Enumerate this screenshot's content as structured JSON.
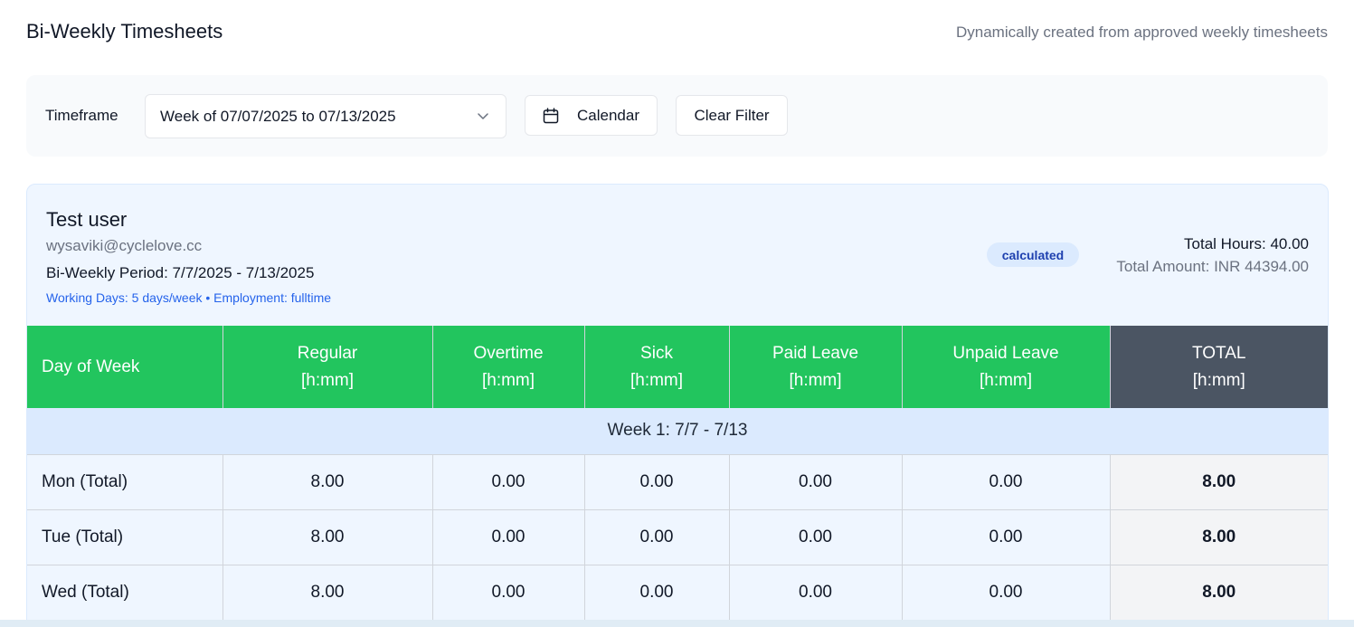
{
  "header": {
    "title": "Bi-Weekly Timesheets",
    "subtitle": "Dynamically created from approved weekly timesheets"
  },
  "filters": {
    "timeframe_label": "Timeframe",
    "timeframe_value": "Week of 07/07/2025 to 07/13/2025",
    "calendar_label": "Calendar",
    "clear_label": "Clear Filter"
  },
  "employee": {
    "name": "Test user",
    "email": "wysaviki@cyclelove.cc",
    "period": "Bi-Weekly Period: 7/7/2025 - 7/13/2025",
    "working_info": "Working Days: 5 days/week • Employment: fulltime",
    "status": "calculated",
    "total_hours": "Total Hours: 40.00",
    "total_amount": "Total Amount: INR 44394.00"
  },
  "table": {
    "columns": [
      {
        "label": "Day of Week",
        "unit": ""
      },
      {
        "label": "Regular",
        "unit": "[h:mm]"
      },
      {
        "label": "Overtime",
        "unit": "[h:mm]"
      },
      {
        "label": "Sick",
        "unit": "[h:mm]"
      },
      {
        "label": "Paid Leave",
        "unit": "[h:mm]"
      },
      {
        "label": "Unpaid Leave",
        "unit": "[h:mm]"
      },
      {
        "label": "TOTAL",
        "unit": "[h:mm]"
      }
    ],
    "week_label": "Week 1: 7/7 - 7/13",
    "rows": [
      {
        "day": "Mon (Total)",
        "regular": "8.00",
        "overtime": "0.00",
        "sick": "0.00",
        "paid": "0.00",
        "unpaid": "0.00",
        "total": "8.00"
      },
      {
        "day": "Tue (Total)",
        "regular": "8.00",
        "overtime": "0.00",
        "sick": "0.00",
        "paid": "0.00",
        "unpaid": "0.00",
        "total": "8.00"
      },
      {
        "day": "Wed (Total)",
        "regular": "8.00",
        "overtime": "0.00",
        "sick": "0.00",
        "paid": "0.00",
        "unpaid": "0.00",
        "total": "8.00"
      }
    ]
  },
  "colors": {
    "header_green": "#22c55e",
    "total_header": "#4b5563",
    "card_bg": "#eff6ff",
    "badge_bg": "#dbeafe",
    "badge_text": "#1e40af",
    "link_blue": "#2563eb"
  }
}
